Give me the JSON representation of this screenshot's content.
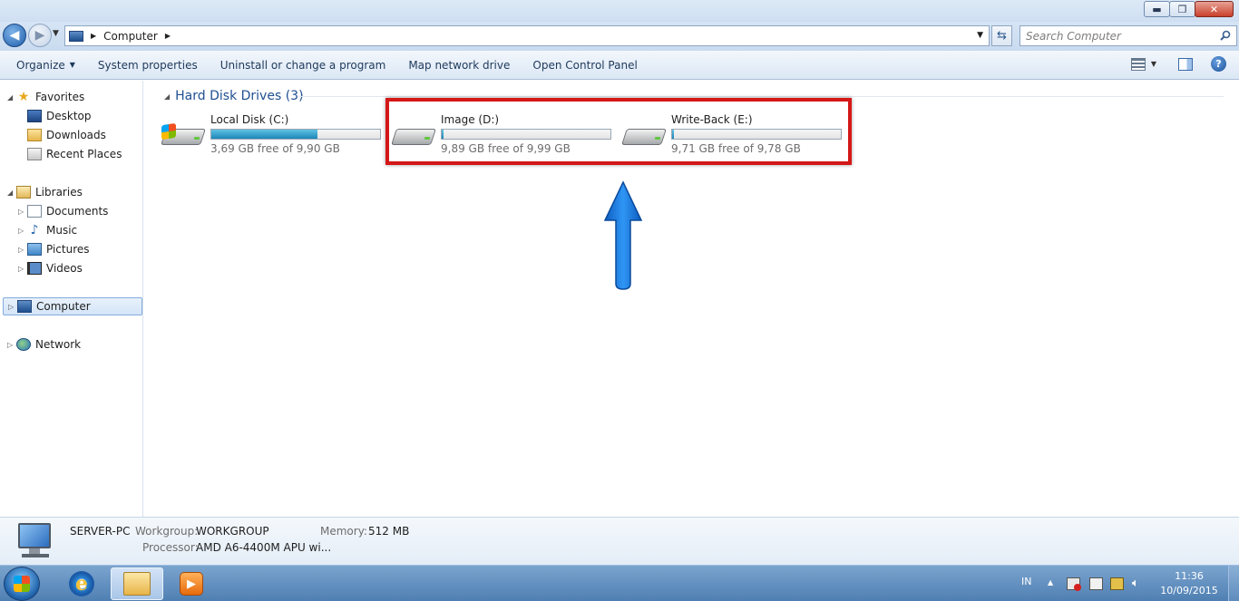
{
  "window": {
    "minimize_glyph": "▬",
    "maximize_glyph": "❐",
    "close_glyph": "✕"
  },
  "address": {
    "breadcrumb": [
      "Computer"
    ],
    "search_placeholder": "Search Computer"
  },
  "toolbar": {
    "organize": "Organize",
    "system_properties": "System properties",
    "uninstall": "Uninstall or change a program",
    "map_network_drive": "Map network drive",
    "open_control_panel": "Open Control Panel"
  },
  "nav": {
    "favorites": "Favorites",
    "desktop": "Desktop",
    "downloads": "Downloads",
    "recent_places": "Recent Places",
    "libraries": "Libraries",
    "documents": "Documents",
    "music": "Music",
    "pictures": "Pictures",
    "videos": "Videos",
    "computer": "Computer",
    "network": "Network"
  },
  "content": {
    "group_header": "Hard Disk Drives (3)",
    "drives": [
      {
        "name": "Local Disk (C:)",
        "free_text": "3,69 GB free of 9,90 GB",
        "used_fraction": 0.63,
        "system": true
      },
      {
        "name": "Image (D:)",
        "free_text": "9,89 GB free of 9,99 GB",
        "used_fraction": 0.01,
        "system": false
      },
      {
        "name": "Write-Back (E:)",
        "free_text": "9,71 GB free of 9,78 GB",
        "used_fraction": 0.01,
        "system": false
      }
    ]
  },
  "details": {
    "computer_name": "SERVER-PC",
    "workgroup_label": "Workgroup:",
    "workgroup_value": "WORKGROUP",
    "memory_label": "Memory:",
    "memory_value": "512 MB",
    "processor_label": "Processor:",
    "processor_value": "AMD A6-4400M APU wi..."
  },
  "taskbar": {
    "language": "IN",
    "time": "11:36",
    "date": "10/09/2015"
  },
  "colors": {
    "highlight_box": "#d41717",
    "annotation_arrow": "#1a7fe0",
    "drive_fill": "#1d86b8"
  }
}
